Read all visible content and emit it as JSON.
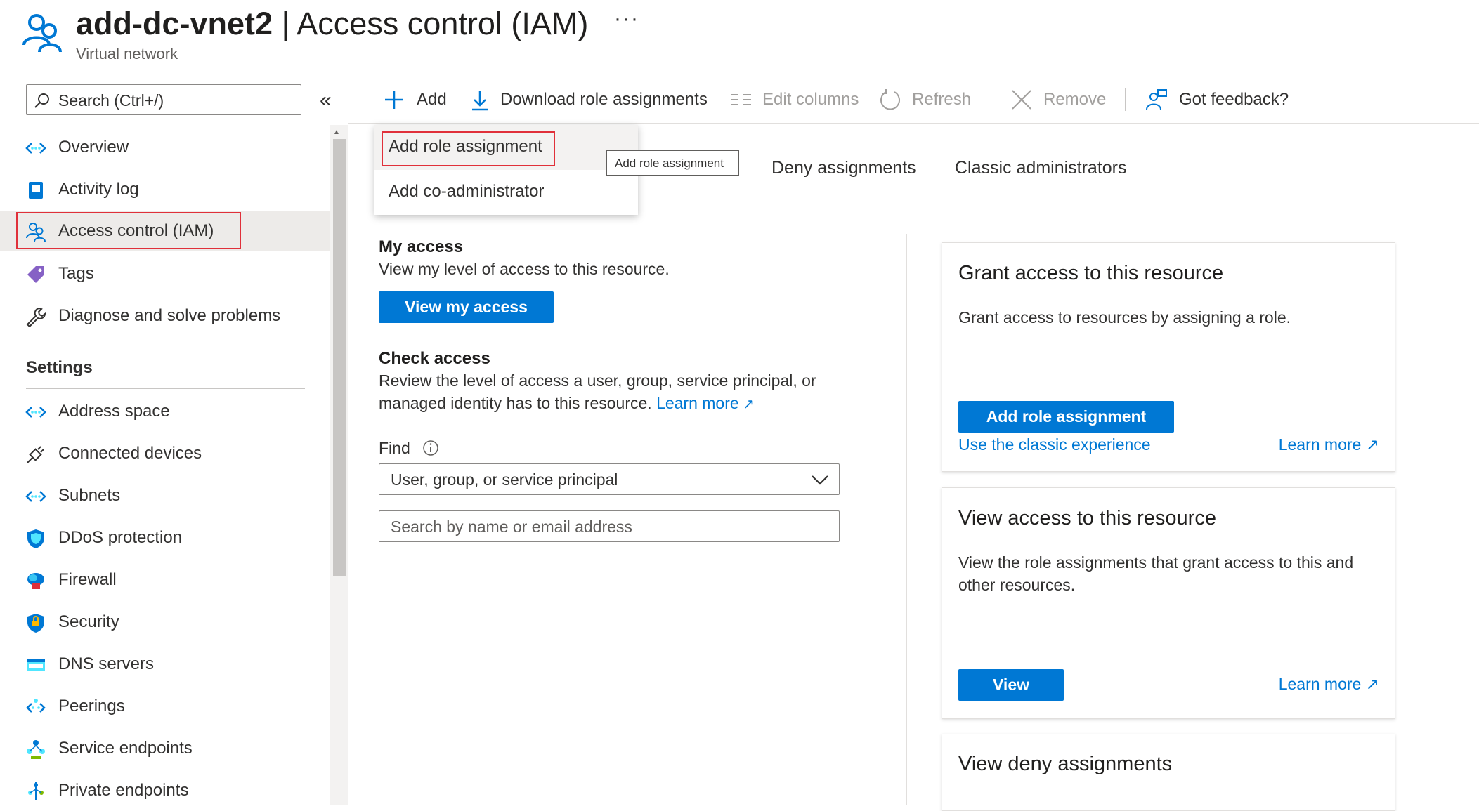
{
  "header": {
    "resource_name": "add-dc-vnet2",
    "separator": " | ",
    "page_title": "Access control (IAM)",
    "more": "···",
    "subtitle": "Virtual network"
  },
  "sidebar": {
    "search_placeholder": "Search (Ctrl+/)",
    "collapse": "«",
    "items_top": [
      {
        "label": "Overview",
        "icon": "overview-icon"
      },
      {
        "label": "Activity log",
        "icon": "activity-log-icon"
      },
      {
        "label": "Access control (IAM)",
        "icon": "people-icon"
      },
      {
        "label": "Tags",
        "icon": "tag-icon"
      },
      {
        "label": "Diagnose and solve problems",
        "icon": "wrench-icon"
      }
    ],
    "settings_title": "Settings",
    "settings_items": [
      {
        "label": "Address space",
        "icon": "address-space-icon"
      },
      {
        "label": "Connected devices",
        "icon": "plug-icon"
      },
      {
        "label": "Subnets",
        "icon": "subnets-icon"
      },
      {
        "label": "DDoS protection",
        "icon": "shield-icon"
      },
      {
        "label": "Firewall",
        "icon": "firewall-icon"
      },
      {
        "label": "Security",
        "icon": "security-shield-icon"
      },
      {
        "label": "DNS servers",
        "icon": "dns-icon"
      },
      {
        "label": "Peerings",
        "icon": "peerings-icon"
      },
      {
        "label": "Service endpoints",
        "icon": "service-endpoints-icon"
      },
      {
        "label": "Private endpoints",
        "icon": "private-endpoints-icon"
      }
    ]
  },
  "toolbar": {
    "add": "Add",
    "download": "Download role assignments",
    "edit_columns": "Edit columns",
    "refresh": "Refresh",
    "remove": "Remove",
    "feedback": "Got feedback?"
  },
  "dropdown": {
    "add_role_assignment": "Add role assignment",
    "add_co_admin": "Add co-administrator",
    "tooltip": "Add role assignment"
  },
  "tabs": [
    "Deny assignments",
    "Classic administrators"
  ],
  "my_access": {
    "title": "My access",
    "desc": "View my level of access to this resource.",
    "button": "View my access"
  },
  "check_access": {
    "title": "Check access",
    "desc": "Review the level of access a user, group, service principal, or managed identity has to this resource.",
    "learn_more": "Learn more",
    "find_label": "Find",
    "select_value": "User, group, or service principal",
    "search_placeholder": "Search by name or email address"
  },
  "cards": {
    "grant": {
      "title": "Grant access to this resource",
      "desc": "Grant access to resources by assigning a role.",
      "button": "Add role assignment",
      "classic_link": "Use the classic experience",
      "learn_more": "Learn more"
    },
    "view": {
      "title": "View access to this resource",
      "desc": "View the role assignments that grant access to this and other resources.",
      "button": "View",
      "learn_more": "Learn more"
    },
    "deny": {
      "title": "View deny assignments"
    }
  },
  "colors": {
    "accent": "#0078d4",
    "highlight_box": "#e0303a",
    "active_bg": "#edebe9"
  }
}
